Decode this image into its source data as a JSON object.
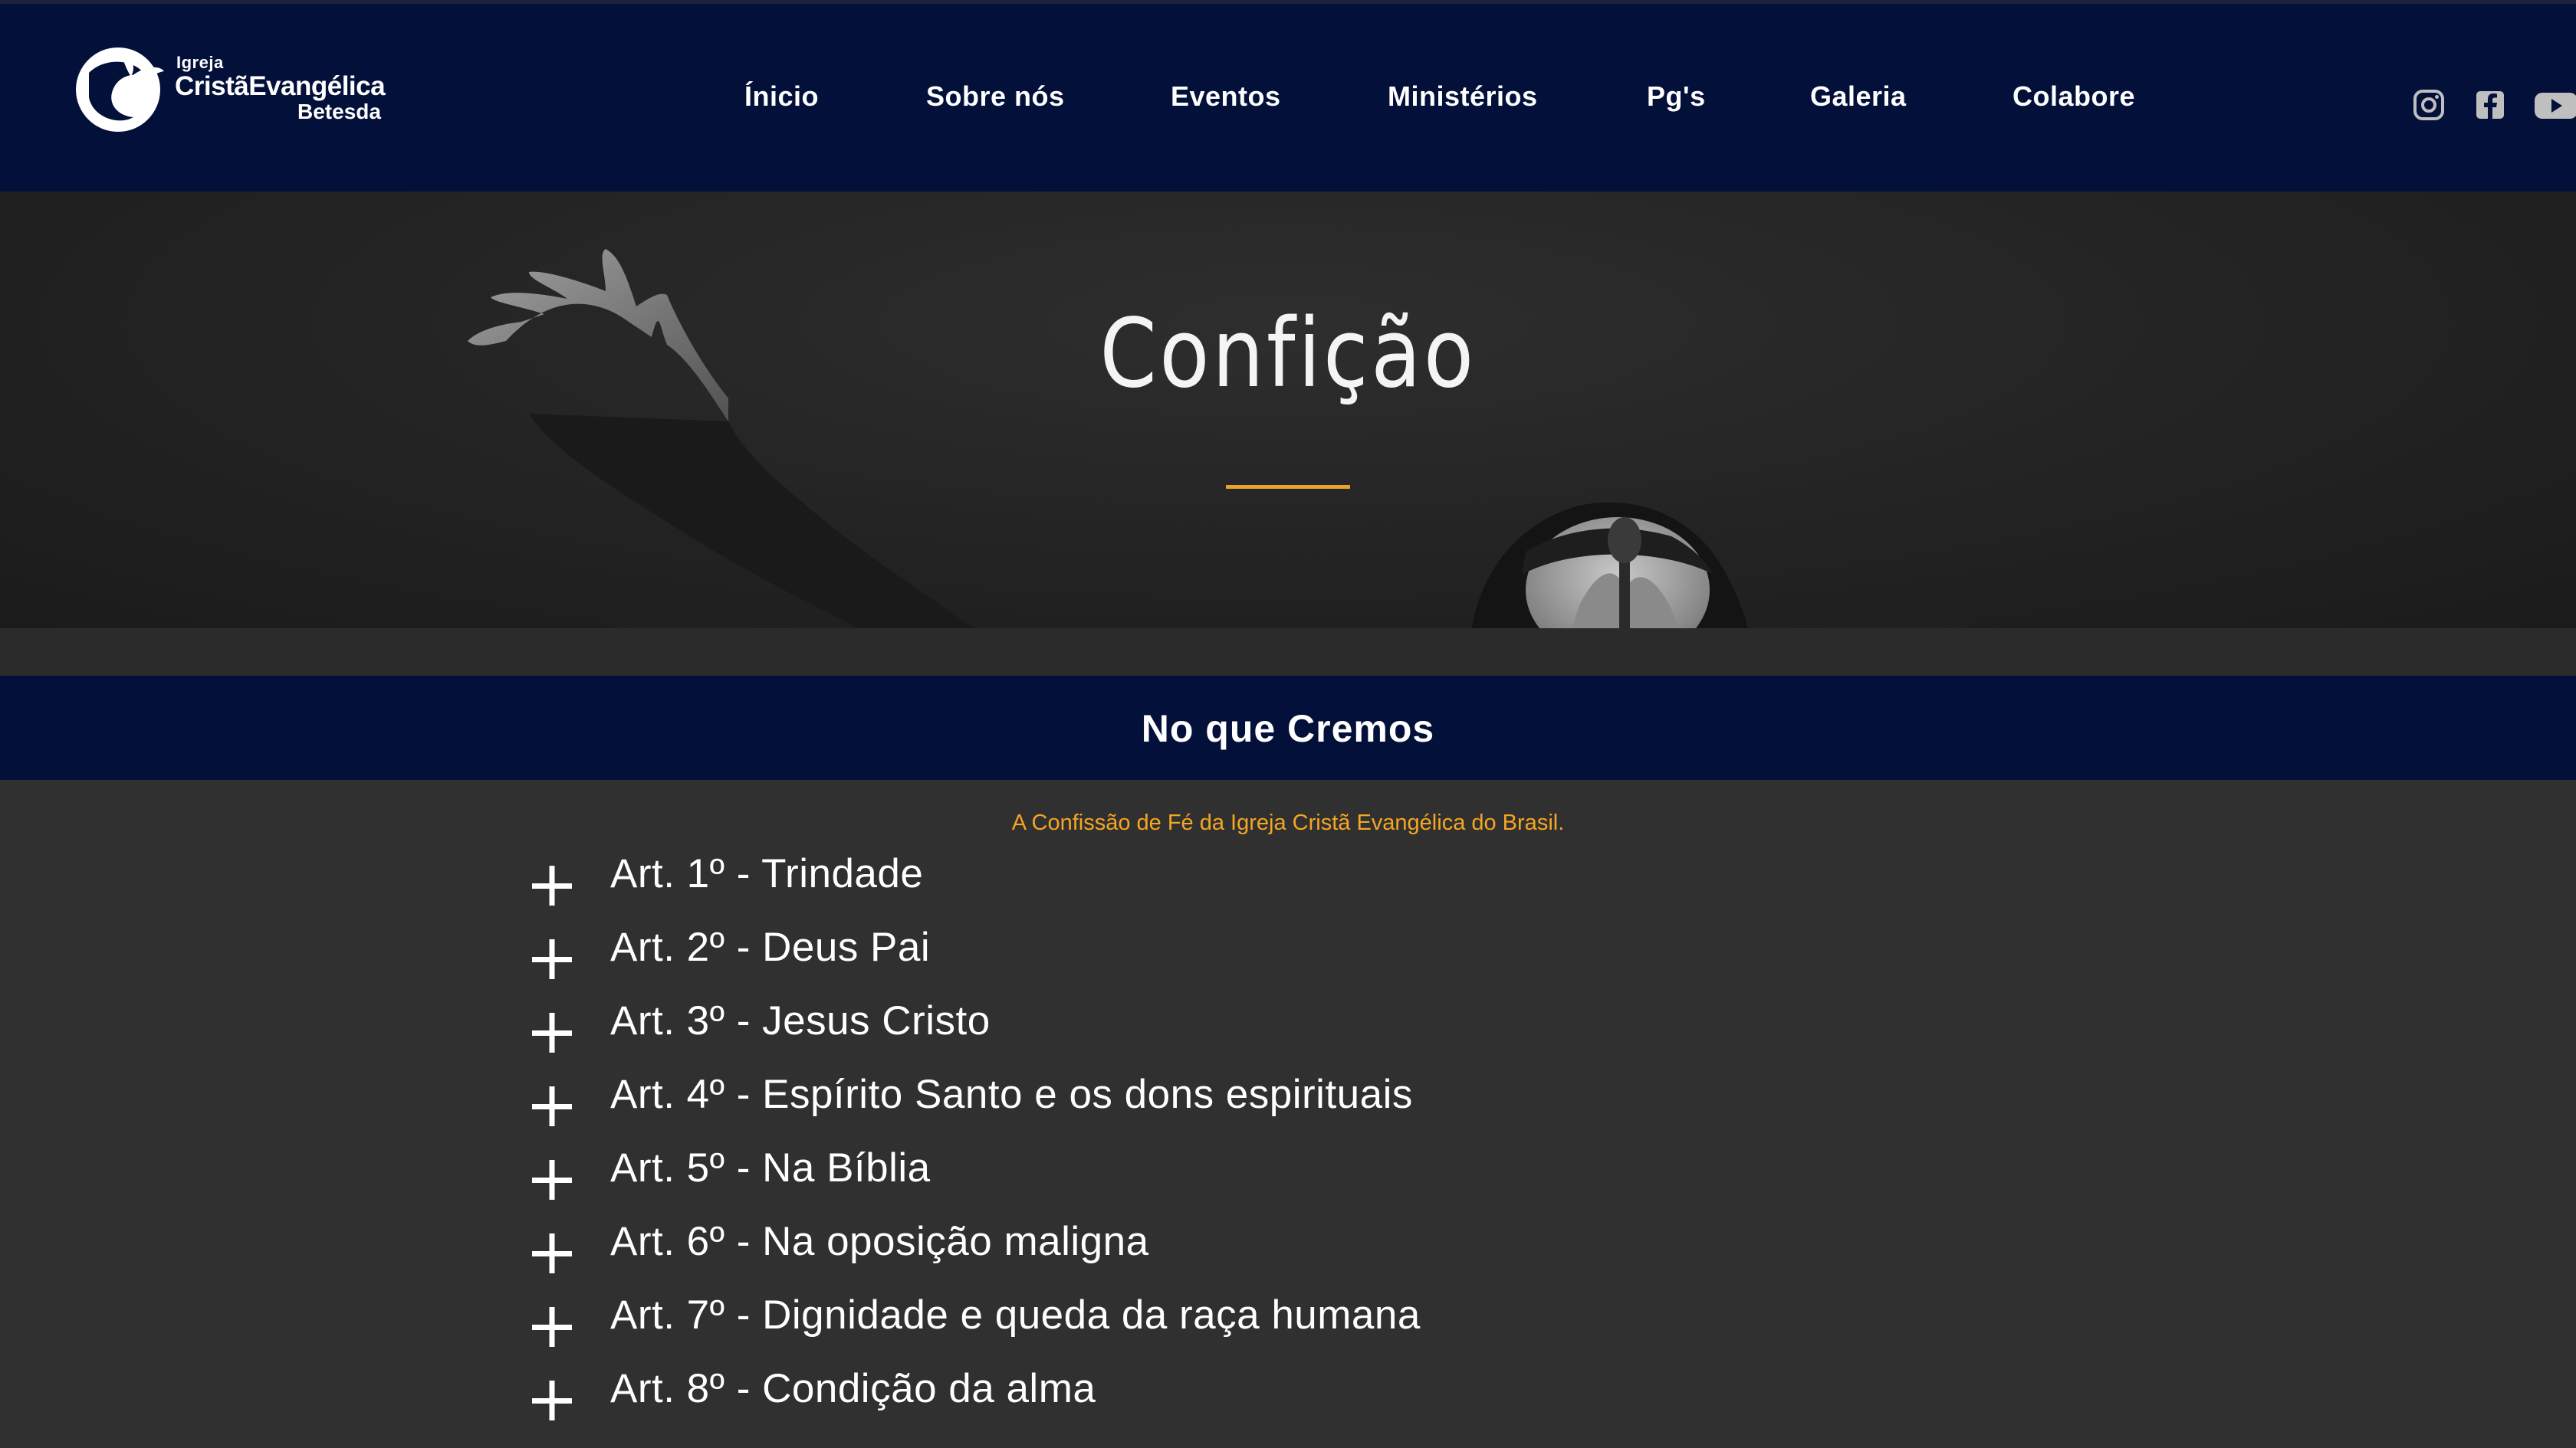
{
  "brand": {
    "line1": "Igreja",
    "line2": "CristãEvangélica",
    "line3": "Betesda"
  },
  "nav": {
    "items": [
      {
        "label": "Ínicio"
      },
      {
        "label": "Sobre nós"
      },
      {
        "label": "Eventos"
      },
      {
        "label": "Ministérios"
      },
      {
        "label": "Pg's"
      },
      {
        "label": "Galeria"
      },
      {
        "label": "Colabore"
      }
    ]
  },
  "social": [
    {
      "icon": "instagram-icon"
    },
    {
      "icon": "facebook-icon"
    },
    {
      "icon": "youtube-icon"
    }
  ],
  "hero": {
    "title": "Confição"
  },
  "section": {
    "title": "No que Cremos",
    "subtitle": "A Confissão de Fé da Igreja Cristã Evangélica do Brasil."
  },
  "articles": [
    {
      "label": "Art. 1º - Trindade"
    },
    {
      "label": "Art. 2º - Deus Pai"
    },
    {
      "label": "Art. 3º - Jesus Cristo"
    },
    {
      "label": "Art. 4º - Espírito Santo e os dons espirituais"
    },
    {
      "label": "Art. 5º - Na Bíblia"
    },
    {
      "label": "Art. 6º - Na oposição maligna"
    },
    {
      "label": "Art. 7º - Dignidade e queda da raça humana"
    },
    {
      "label": "Art. 8º - Condição da alma"
    }
  ],
  "colors": {
    "navy": "#03103a",
    "accent": "#e8a32d",
    "content_bg": "#303030"
  }
}
